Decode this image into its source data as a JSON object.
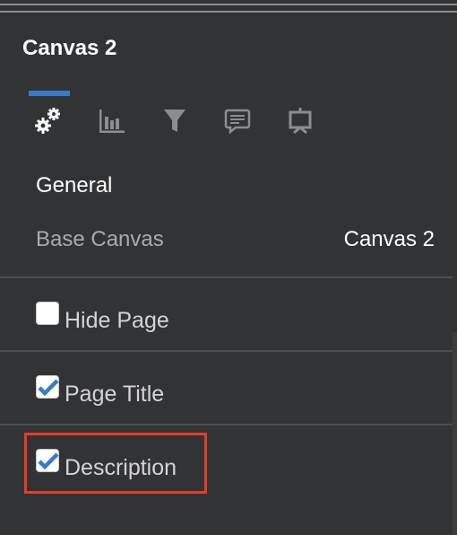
{
  "panel": {
    "title": "Canvas 2",
    "accent_color": "#3a7bc8",
    "highlight_color": "#e53d25",
    "tabs": [
      {
        "icon": "gears-icon",
        "active": true
      },
      {
        "icon": "bar-chart-icon",
        "active": false
      },
      {
        "icon": "filter-icon",
        "active": false
      },
      {
        "icon": "comment-icon",
        "active": false
      },
      {
        "icon": "presentation-icon",
        "active": false
      }
    ],
    "section_title": "General",
    "base_canvas": {
      "label": "Base Canvas",
      "value": "Canvas 2"
    },
    "options": [
      {
        "label": "Hide Page",
        "checked": false
      },
      {
        "label": "Page Title",
        "checked": true
      },
      {
        "label": "Description",
        "checked": true
      }
    ]
  }
}
